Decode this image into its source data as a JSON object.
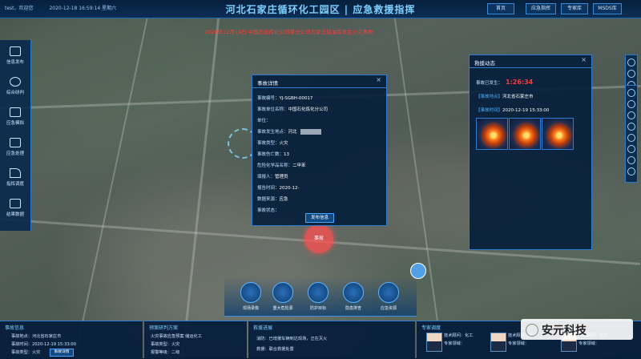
{
  "topbar": {
    "user": "test，欢迎您",
    "datetime": "2020-12-18 16:59:14 星期六",
    "title": "河北石家庄循环化工园区 | 应急救援指挥",
    "buttons": [
      "首页",
      "应急指挥",
      "专家库",
      "MSDS库"
    ]
  },
  "marquee": "2020年12月19日 中国石化炼化公司某分公司石家庄储油库发生火灾事故",
  "left_nav": [
    "信息发布",
    "综合研判",
    "应急模拟",
    "应急处理",
    "指挥调度",
    "结果数据"
  ],
  "incident": {
    "title": "事故详情",
    "fields": [
      {
        "k": "事故编号：",
        "v": "YJ-SGBH-00017"
      },
      {
        "k": "事故单位名称：",
        "v": "中国石化炼化分公司"
      },
      {
        "k": "单位：",
        "v": ""
      },
      {
        "k": "事故发生地点：",
        "v": "河北"
      },
      {
        "k": "事故类型：",
        "v": "火灾"
      },
      {
        "k": "事故伤亡数：",
        "v": "13"
      },
      {
        "k": "危险化学品名称：",
        "v": "二甲苯"
      },
      {
        "k": "填报人：",
        "v": "管理员"
      },
      {
        "k": "报告时间：",
        "v": "2020-12-"
      },
      {
        "k": "数据来源：",
        "v": "应急"
      },
      {
        "k": "事故状态：",
        "v": ""
      }
    ],
    "button": "发布信息"
  },
  "rescue": {
    "title": "救援动态",
    "elapsed_label": "事故已发生：",
    "elapsed": "1:26:34",
    "loc_label": "【事故地点】",
    "loc": "河北省石家庄市",
    "time_label": "【事故时间】",
    "time": "2020-12-19 15:33:00"
  },
  "map_marker": "事故",
  "tools": [
    "现场录像",
    "重大危险源",
    "防护目标",
    "隐患排查",
    "应急资源"
  ],
  "bottom": {
    "event": {
      "title": "事故信息",
      "rows": [
        "事故地点：河北省石家庄市",
        "事故时间：2020-12-19 15:33:00",
        "事故类型：火灾"
      ],
      "badge": "事故详情"
    },
    "plan": {
      "title": "预案研判方案",
      "rows": [
        "火灾事故应急预案  储运化工",
        "事故类型：火灾",
        "报警等级：二级"
      ]
    },
    "progress": {
      "title": "救援进展",
      "rows": [
        "消防：已增援车辆到达现场，正在灭火",
        "救援：联合救援处置"
      ]
    },
    "experts": {
      "title": "专家调度",
      "list": [
        {
          "role": "技术顾问：",
          "name": "化工",
          "field": "专家领域："
        },
        {
          "role": "技术顾问：",
          "name": "化工",
          "field": "专家领域："
        },
        {
          "role": "技术顾问：",
          "name": "化工",
          "field": "专家领域："
        }
      ]
    }
  },
  "watermark": "安元科技"
}
